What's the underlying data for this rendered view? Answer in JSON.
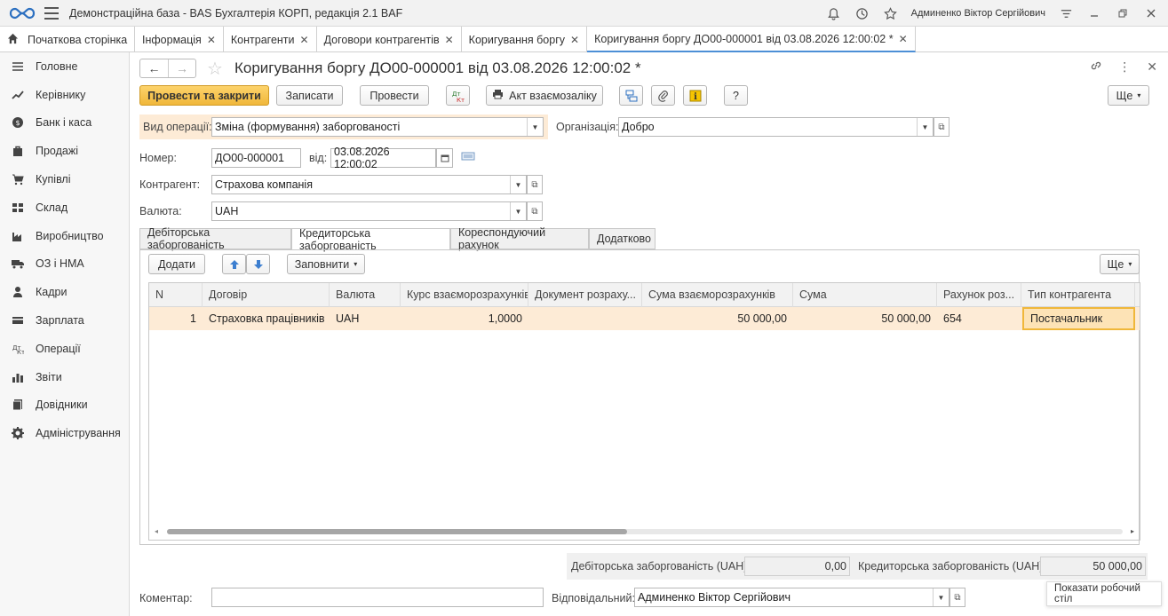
{
  "titlebar": {
    "app_title": "Демонстраційна база - BAS Бухгалтерія КОРП, редакція 2.1 BAF",
    "user": "Админенко Віктор Сергійович"
  },
  "tabs": {
    "home": "Початкова сторінка",
    "items": [
      {
        "label": "Інформація"
      },
      {
        "label": "Контрагенти"
      },
      {
        "label": "Договори контрагентів"
      },
      {
        "label": "Коригування боргу"
      },
      {
        "label": "Коригування боргу ДО00-000001 від 03.08.2026 12:00:02 *"
      }
    ]
  },
  "sidebar": {
    "items": [
      {
        "label": "Головне",
        "icon": "menu-icon"
      },
      {
        "label": "Керівнику",
        "icon": "trend-icon"
      },
      {
        "label": "Банк і каса",
        "icon": "coin-icon"
      },
      {
        "label": "Продажі",
        "icon": "bag-icon"
      },
      {
        "label": "Купівлі",
        "icon": "cart-icon"
      },
      {
        "label": "Склад",
        "icon": "warehouse-icon"
      },
      {
        "label": "Виробництво",
        "icon": "factory-icon"
      },
      {
        "label": "ОЗ і НМА",
        "icon": "truck-icon"
      },
      {
        "label": "Кадри",
        "icon": "person-icon"
      },
      {
        "label": "Зарплата",
        "icon": "wallet-icon"
      },
      {
        "label": "Операції",
        "icon": "operations-icon"
      },
      {
        "label": "Звіти",
        "icon": "chart-icon"
      },
      {
        "label": "Довідники",
        "icon": "book-icon"
      },
      {
        "label": "Адміністрування",
        "icon": "gear-icon"
      }
    ]
  },
  "doc": {
    "title": "Коригування боргу ДО00-000001 від 03.08.2026 12:00:02 *"
  },
  "toolbar": {
    "post_close": "Провести та закрити",
    "save": "Записати",
    "post": "Провести",
    "dtkt": "Дт Кт",
    "act": "Акт взаємозаліку",
    "help": "?",
    "more": "Ще"
  },
  "form": {
    "op_label": "Вид операції:",
    "op_value": "Зміна (формування) заборгованості",
    "org_label": "Організація:",
    "org_value": "Добро",
    "num_label": "Номер:",
    "num_value": "ДО00-000001",
    "date_label": "від:",
    "date_value": "03.08.2026 12:00:02",
    "contractor_label": "Контрагент:",
    "contractor_value": "Страхова компанія",
    "currency_label": "Валюта:",
    "currency_value": "UAH"
  },
  "form_tabs": [
    {
      "label": "Дебіторська заборгованість"
    },
    {
      "label": "Кредиторська заборгованість"
    },
    {
      "label": "Кореспондуючий рахунок"
    },
    {
      "label": "Додатково"
    }
  ],
  "table_toolbar": {
    "add": "Додати",
    "fill": "Заповнити",
    "more": "Ще"
  },
  "table": {
    "columns": [
      "N",
      "Договір",
      "Валюта",
      "Курс взаєморозрахунків",
      "Документ розраху...",
      "Сума взаєморозрахунків",
      "Сума",
      "Рахунок роз...",
      "Тип контрагента"
    ],
    "rows": [
      {
        "n": "1",
        "contract": "Страховка працівників",
        "currency": "UAH",
        "rate": "1,0000",
        "doc": "",
        "sum_settle": "50 000,00",
        "sum": "50 000,00",
        "account": "654",
        "type": "Постачальник"
      }
    ]
  },
  "totals": {
    "debit_label": "Дебіторська заборгованість (UAH):",
    "debit_value": "0,00",
    "credit_label": "Кредиторська заборгованість (UAH):",
    "credit_value": "50 000,00"
  },
  "footer": {
    "comment_label": "Коментар:",
    "comment_value": "",
    "responsible_label": "Відповідальний:",
    "responsible_value": "Админенко Віктор Сергійович"
  },
  "tooltip": "Показати робочий стіл"
}
